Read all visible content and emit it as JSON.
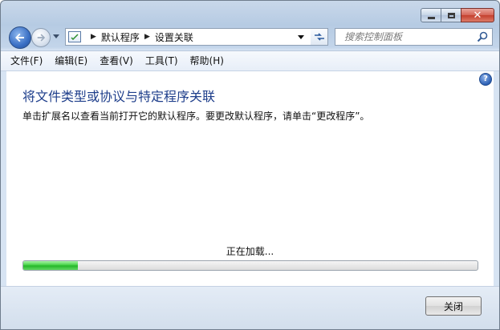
{
  "address": {
    "segments": [
      "默认程序",
      "设置关联"
    ]
  },
  "search": {
    "placeholder": "搜索控制面板"
  },
  "menu": {
    "items": [
      "文件(F)",
      "编辑(E)",
      "查看(V)",
      "工具(T)",
      "帮助(H)"
    ]
  },
  "page": {
    "title": "将文件类型或协议与特定程序关联",
    "description": "单击扩展名以查看当前打开它的默认程序。要更改默认程序，请单击“更改程序”。",
    "loading_text": "正在加载...",
    "progress_percent": 12
  },
  "footer": {
    "close_label": "关闭"
  },
  "colors": {
    "title_blue": "#1e3e8b",
    "progress_green": "#2fc232",
    "chrome_blue": "#c9d8ea"
  },
  "icons": {
    "back": "back-arrow-icon",
    "forward": "forward-arrow-icon",
    "refresh": "refresh-icon",
    "search": "search-icon",
    "help": "help-icon",
    "control-panel": "control-panel-icon"
  }
}
